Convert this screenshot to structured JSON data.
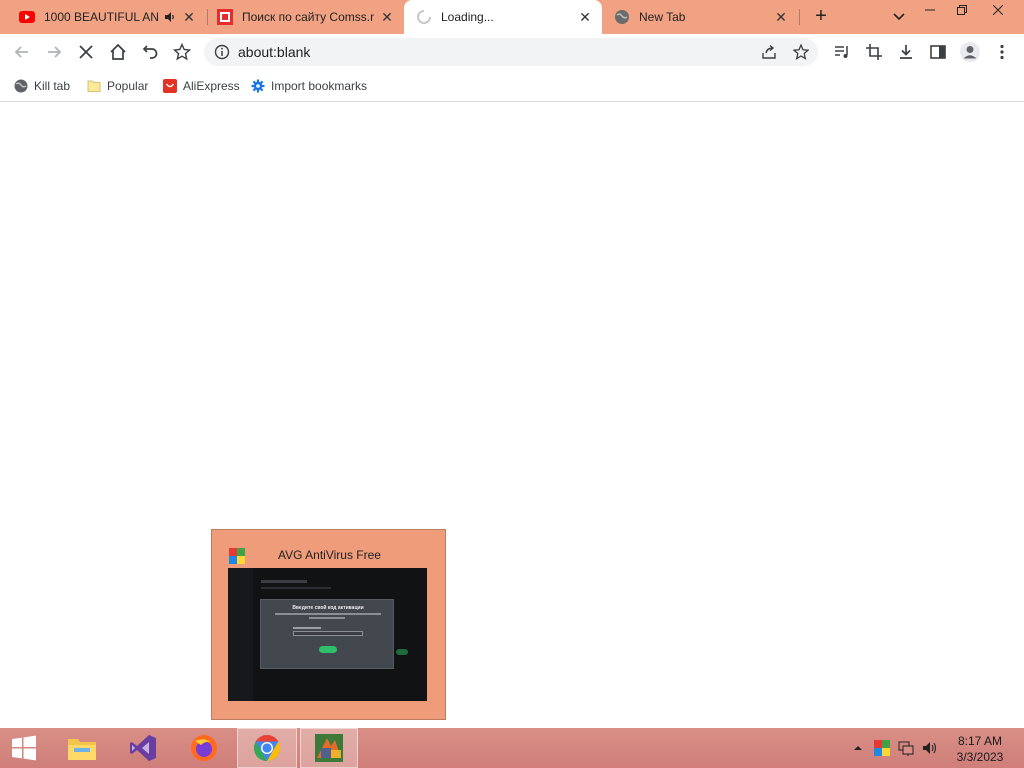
{
  "tabs": [
    {
      "title": "1000 BEAUTIFUL AN",
      "icon": "youtube-icon",
      "audio": true,
      "active": false
    },
    {
      "title": "Поиск по сайту Comss.r",
      "icon": "comss-icon",
      "audio": false,
      "active": false
    },
    {
      "title": "Loading...",
      "icon": "loading-spinner-icon",
      "audio": false,
      "active": true
    },
    {
      "title": "New Tab",
      "icon": "globe-icon",
      "audio": false,
      "active": false
    }
  ],
  "omnibox": {
    "url": "about:blank"
  },
  "bookmarks": [
    {
      "label": "Kill tab",
      "icon": "globe-icon"
    },
    {
      "label": "Popular",
      "icon": "folder-icon"
    },
    {
      "label": "AliExpress",
      "icon": "aliexpress-icon"
    },
    {
      "label": "Import bookmarks",
      "icon": "gear-icon"
    }
  ],
  "preview": {
    "title": "AVG AntiVirus Free",
    "icon": "avg-icon",
    "thumbnail": {
      "dialog_title": "Введите свой код активации"
    }
  },
  "taskbar": {
    "apps": [
      "windows-start-icon",
      "file-explorer-icon",
      "visual-studio-icon",
      "firefox-icon",
      "chrome-icon",
      "avg-taskbar-icon"
    ],
    "active_app": "chrome-icon"
  },
  "clock": {
    "time": "8:17 AM",
    "date": "3/3/2023"
  },
  "colors": {
    "tabstrip": "#f1a283",
    "taskbar": "#d88f86",
    "preview": "#ee9c79"
  }
}
